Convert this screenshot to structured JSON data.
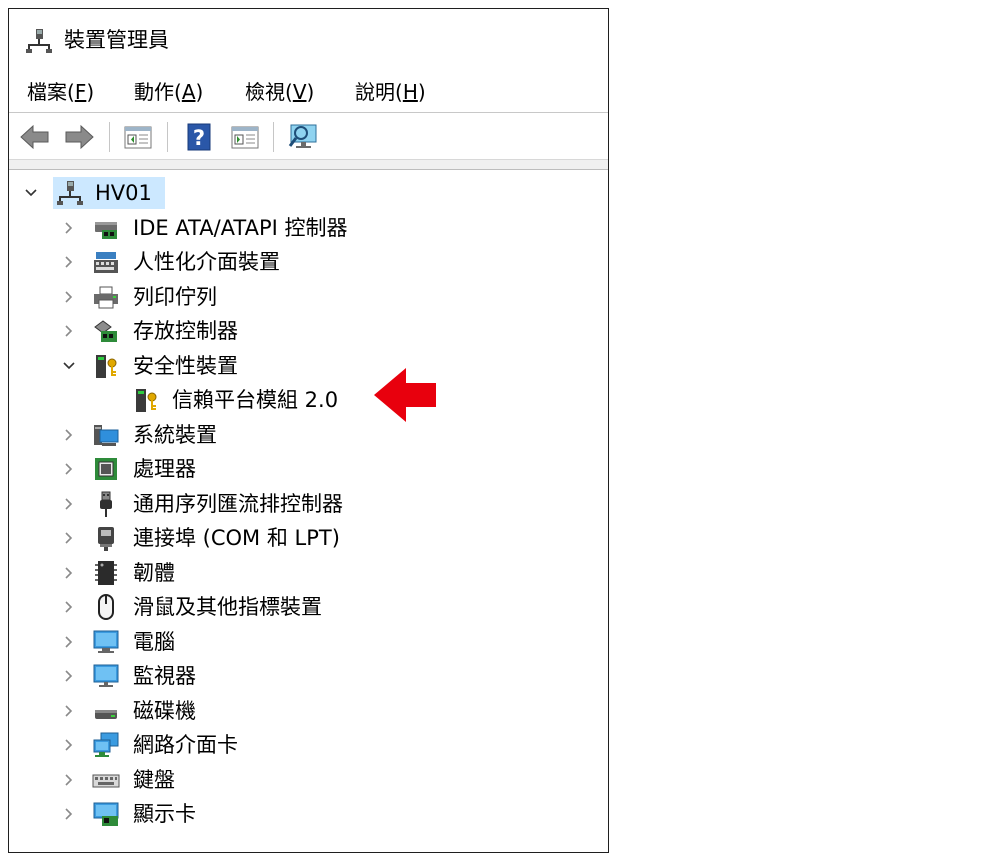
{
  "window": {
    "title": "裝置管理員"
  },
  "menu": [
    {
      "text": "檔案(",
      "accel": "F",
      "close": ")"
    },
    {
      "text": "動作(",
      "accel": "A",
      "close": ")"
    },
    {
      "text": "檢視(",
      "accel": "V",
      "close": ")"
    },
    {
      "text": "說明(",
      "accel": "H",
      "close": ")"
    }
  ],
  "toolbar": {
    "icons": [
      "back-arrow-icon",
      "forward-arrow-icon",
      "properties-icon",
      "help-icon",
      "update-driver-icon",
      "scan-hardware-icon"
    ]
  },
  "tree": {
    "root": {
      "label": "HV01",
      "expanded": true
    },
    "items": [
      {
        "label": "IDE ATA/ATAPI 控制器",
        "icon": "ide-controller-icon"
      },
      {
        "label": "人性化介面裝置",
        "icon": "hid-icon"
      },
      {
        "label": "列印佇列",
        "icon": "printer-icon"
      },
      {
        "label": "存放控制器",
        "icon": "storage-controller-icon"
      },
      {
        "label": "安全性裝置",
        "icon": "security-device-icon",
        "expanded": true,
        "children": [
          {
            "label": "信賴平台模組 2.0",
            "icon": "tpm-icon"
          }
        ]
      },
      {
        "label": "系統裝置",
        "icon": "system-device-icon"
      },
      {
        "label": "處理器",
        "icon": "processor-icon"
      },
      {
        "label": "通用序列匯流排控制器",
        "icon": "usb-controller-icon"
      },
      {
        "label": "連接埠 (COM 和 LPT)",
        "icon": "port-icon"
      },
      {
        "label": "韌體",
        "icon": "firmware-icon"
      },
      {
        "label": "滑鼠及其他指標裝置",
        "icon": "mouse-icon"
      },
      {
        "label": "電腦",
        "icon": "computer-icon"
      },
      {
        "label": "監視器",
        "icon": "monitor-icon"
      },
      {
        "label": "磁碟機",
        "icon": "disk-drive-icon"
      },
      {
        "label": "網路介面卡",
        "icon": "network-adapter-icon"
      },
      {
        "label": "鍵盤",
        "icon": "keyboard-icon"
      },
      {
        "label": "顯示卡",
        "icon": "display-adapter-icon"
      }
    ]
  },
  "colors": {
    "selection": "#cce8ff",
    "annotation_arrow": "#e8000d",
    "border": "#1f1f1f"
  }
}
